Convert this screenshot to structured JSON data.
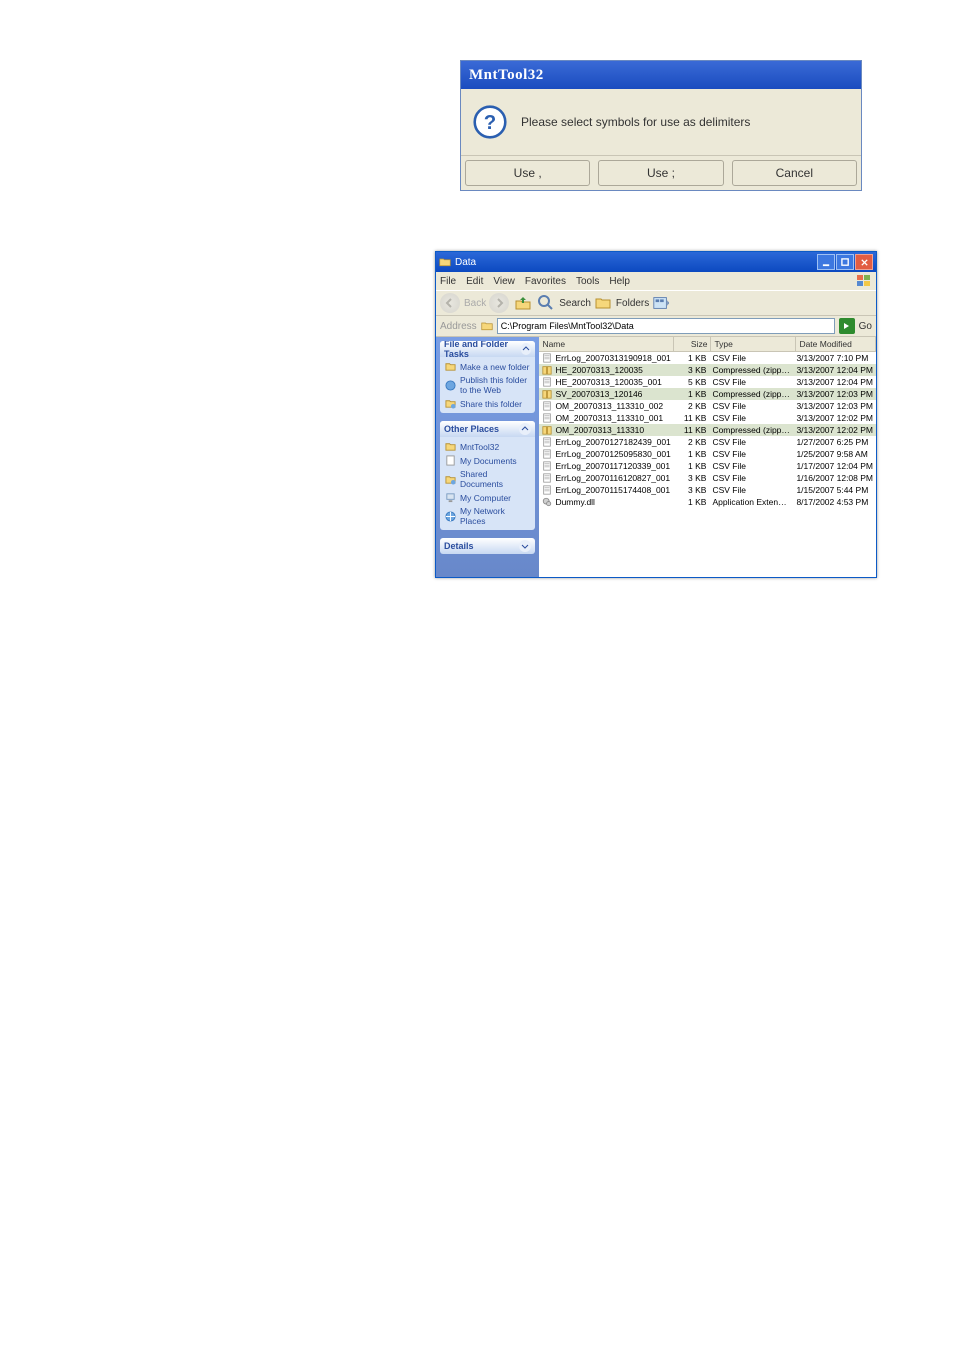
{
  "dialog": {
    "title": "MntTool32",
    "message": "Please select symbols for use as delimiters",
    "btn_use_comma": "Use ,",
    "btn_use_semicolon": "Use ;",
    "btn_cancel": "Cancel"
  },
  "explorer": {
    "title": "Data",
    "menu": {
      "file": "File",
      "edit": "Edit",
      "view": "View",
      "favorites": "Favorites",
      "tools": "Tools",
      "help": "Help"
    },
    "toolbar": {
      "search": "Search",
      "folders": "Folders"
    },
    "address_label": "Address",
    "address_value": "C:\\Program Files\\MntTool32\\Data",
    "go_label": "Go",
    "columns": {
      "name": "Name",
      "size": "Size",
      "type": "Type",
      "date": "Date Modified"
    },
    "side": {
      "tasks": {
        "title": "File and Folder Tasks",
        "items": [
          "Make a new folder",
          "Publish this folder to the Web",
          "Share this folder"
        ]
      },
      "places": {
        "title": "Other Places",
        "items": [
          "MntTool32",
          "My Documents",
          "Shared Documents",
          "My Computer",
          "My Network Places"
        ]
      },
      "details": {
        "title": "Details"
      }
    },
    "files": [
      {
        "name": "ErrLog_20070313190918_001",
        "size": "1 KB",
        "type": "CSV File",
        "date": "3/13/2007 7:10 PM",
        "icon": "txt"
      },
      {
        "name": "HE_20070313_120035",
        "size": "3 KB",
        "type": "Compressed (zippe...",
        "date": "3/13/2007 12:04 PM",
        "icon": "zip",
        "sel": true
      },
      {
        "name": "HE_20070313_120035_001",
        "size": "5 KB",
        "type": "CSV File",
        "date": "3/13/2007 12:04 PM",
        "icon": "txt"
      },
      {
        "name": "SV_20070313_120146",
        "size": "1 KB",
        "type": "Compressed (zippe...",
        "date": "3/13/2007 12:03 PM",
        "icon": "zip",
        "sel": true
      },
      {
        "name": "OM_20070313_113310_002",
        "size": "2 KB",
        "type": "CSV File",
        "date": "3/13/2007 12:03 PM",
        "icon": "txt"
      },
      {
        "name": "OM_20070313_113310_001",
        "size": "11 KB",
        "type": "CSV File",
        "date": "3/13/2007 12:02 PM",
        "icon": "txt"
      },
      {
        "name": "OM_20070313_113310",
        "size": "11 KB",
        "type": "Compressed (zippe...",
        "date": "3/13/2007 12:02 PM",
        "icon": "zip",
        "sel": true
      },
      {
        "name": "ErrLog_20070127182439_001",
        "size": "2 KB",
        "type": "CSV File",
        "date": "1/27/2007 6:25 PM",
        "icon": "txt"
      },
      {
        "name": "ErrLog_20070125095830_001",
        "size": "1 KB",
        "type": "CSV File",
        "date": "1/25/2007 9:58 AM",
        "icon": "txt"
      },
      {
        "name": "ErrLog_20070117120339_001",
        "size": "1 KB",
        "type": "CSV File",
        "date": "1/17/2007 12:04 PM",
        "icon": "txt"
      },
      {
        "name": "ErrLog_20070116120827_001",
        "size": "3 KB",
        "type": "CSV File",
        "date": "1/16/2007 12:08 PM",
        "icon": "txt"
      },
      {
        "name": "ErrLog_20070115174408_001",
        "size": "3 KB",
        "type": "CSV File",
        "date": "1/15/2007 5:44 PM",
        "icon": "txt"
      },
      {
        "name": "Dummy.dll",
        "size": "1 KB",
        "type": "Application Extension",
        "date": "8/17/2002 4:53 PM",
        "icon": "dll"
      }
    ]
  }
}
